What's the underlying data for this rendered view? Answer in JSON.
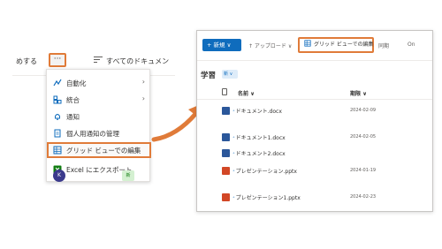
{
  "left_toolbar": {
    "left_text": "めする",
    "ellipsis": "···",
    "filter_text": "すべてのドキュメン"
  },
  "context_menu": {
    "items": [
      {
        "icon": "automate-icon",
        "label": "自動化",
        "submenu": true
      },
      {
        "icon": "integrate-icon",
        "label": "統合",
        "submenu": true
      },
      {
        "icon": "bell-icon",
        "label": "通知",
        "submenu": false
      },
      {
        "icon": "personal-alert-icon",
        "label": "個人用通知の管理",
        "submenu": false
      },
      {
        "icon": "grid-icon",
        "label": "グリッド ビューでの編集",
        "submenu": false,
        "highlighted": true
      },
      {
        "icon": "excel-icon",
        "label": "Excel にエクスポート",
        "submenu": false
      }
    ]
  },
  "left_row": {
    "avatar_initial": "K",
    "badge": "新"
  },
  "right_toolbar": {
    "new_label": "+ 新規 ∨",
    "upload_label": "↑ アップロード ∨",
    "gridview_label": "グリッド ビューでの編集",
    "sync_label": "同期",
    "onedrive_label": "On"
  },
  "library": {
    "title": "学習",
    "view_badge": "新 ∨",
    "columns": {
      "name": "名前 ∨",
      "modified": "期限 ∨"
    },
    "files": [
      {
        "name": "ドキュメント.docx",
        "type": "word",
        "date": "2024-02-09"
      },
      {
        "name": "ドキュメント1.docx",
        "type": "word",
        "date": "2024-02-05"
      },
      {
        "name": "ドキュメント2.docx",
        "type": "word",
        "date": ""
      },
      {
        "name": "プレゼンテーション.pptx",
        "type": "ppt",
        "date": "2024-01-19"
      },
      {
        "name": "プレゼンテーション1.pptx",
        "type": "ppt",
        "date": "2024-02-23"
      }
    ]
  },
  "colors": {
    "accent": "#e07b39",
    "brand": "#0f6cbd",
    "word": "#2b579a",
    "ppt": "#d24726"
  }
}
